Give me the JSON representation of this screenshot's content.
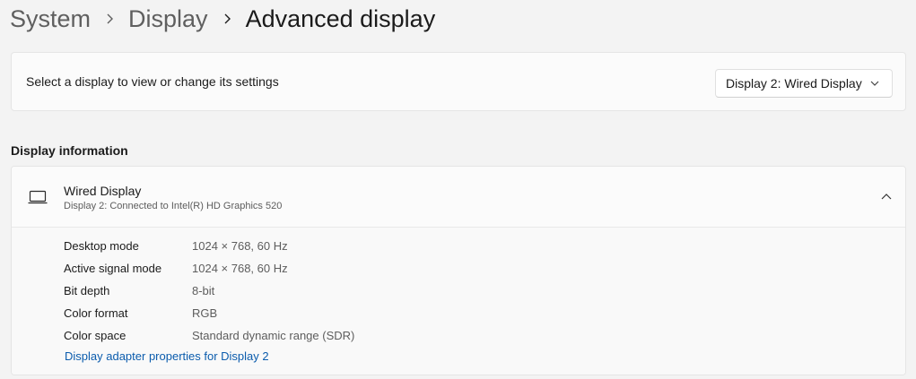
{
  "breadcrumb": {
    "items": [
      "System",
      "Display",
      "Advanced display"
    ]
  },
  "select_display": {
    "label": "Select a display to view or change its settings",
    "selected": "Display 2: Wired Display"
  },
  "display_information": {
    "heading": "Display information",
    "title": "Wired Display",
    "subtitle": "Display 2: Connected to Intel(R) HD Graphics 520",
    "icon": "monitor-icon",
    "expanded": true,
    "rows": [
      {
        "label": "Desktop mode",
        "value": "1024 × 768, 60 Hz"
      },
      {
        "label": "Active signal mode",
        "value": "1024 × 768, 60 Hz"
      },
      {
        "label": "Bit depth",
        "value": "8-bit"
      },
      {
        "label": "Color format",
        "value": "RGB"
      },
      {
        "label": "Color space",
        "value": "Standard dynamic range (SDR)"
      }
    ],
    "link": "Display adapter properties for Display 2"
  },
  "colors": {
    "background": "#f3f3f3",
    "card": "#fbfbfb",
    "link": "#0b5cad",
    "secondary_text": "#5d5d5d"
  }
}
